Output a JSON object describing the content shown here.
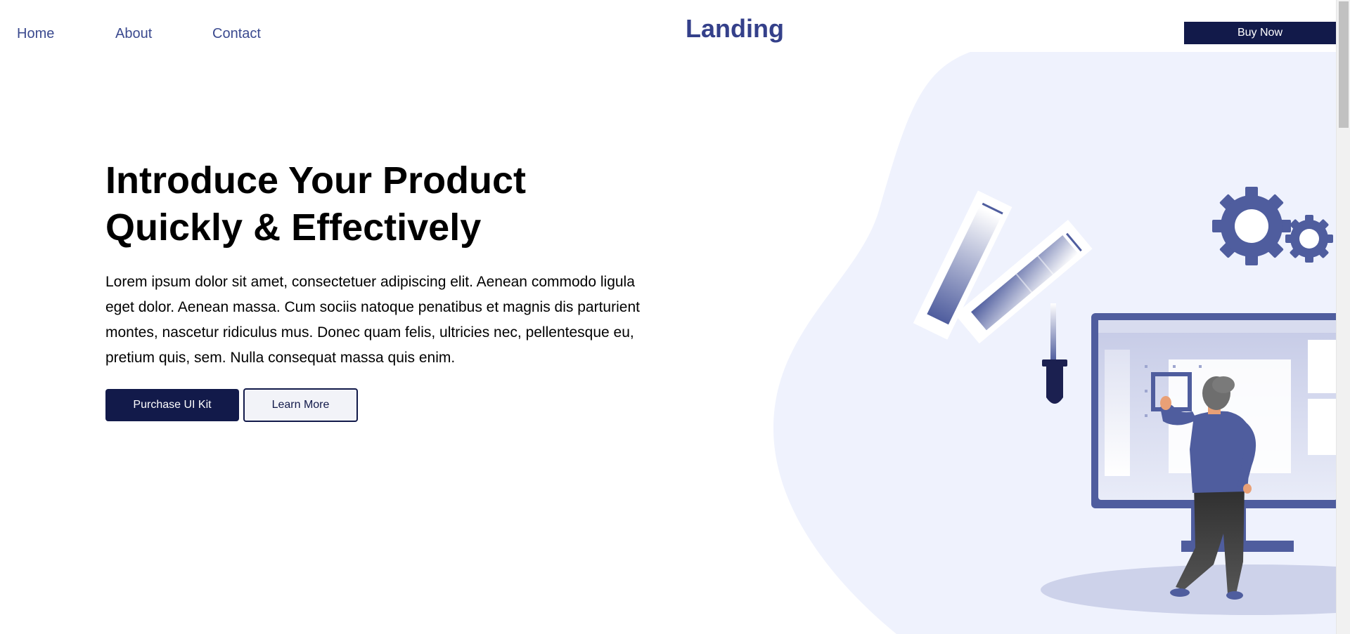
{
  "nav": {
    "links": [
      "Home",
      "About",
      "Contact"
    ],
    "brand": "Landing",
    "buy_label": "Buy Now"
  },
  "hero": {
    "title_line1": "Introduce Your Product",
    "title_line2": "Quickly & Effectively",
    "body": "Lorem ipsum dolor sit amet, consectetuer adipiscing elit. Aenean commodo ligula eget dolor. Aenean massa. Cum sociis natoque penatibus et magnis dis parturient montes, nascetur ridiculus mus. Donec quam felis, ultricies nec, pellentesque eu, pretium quis, sem. Nulla consequat massa quis enim.",
    "primary_cta": "Purchase UI Kit",
    "secondary_cta": "Learn More"
  },
  "colors": {
    "accent_dark": "#121a4a",
    "brand_blue": "#34408a",
    "illustration_blue": "#4f5d9e",
    "blob": "#eff2fd"
  },
  "illustration": {
    "icons": [
      "gear-icon",
      "color-swatch-icon",
      "eyedropper-icon",
      "monitor-icon",
      "person-figure"
    ]
  }
}
